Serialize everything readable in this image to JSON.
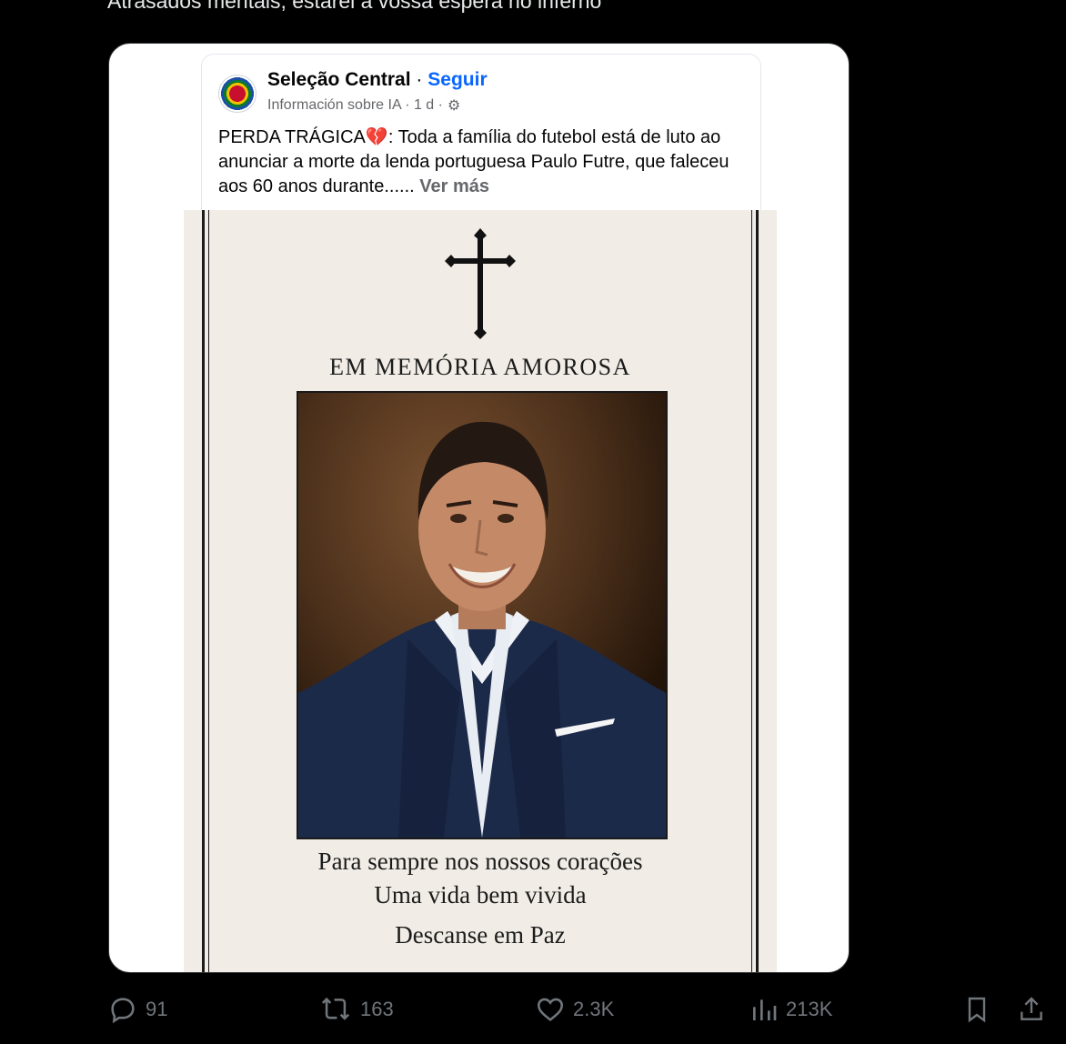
{
  "tweet": {
    "text": "Atrasados mentais, estarei à vossa espera no inferno"
  },
  "fb_post": {
    "page_name": "Seleção Central",
    "separator": "·",
    "follow": "Seguir",
    "meta_info": "Información sobre IA · 1 d ·",
    "text_before_emoji": "PERDA TRÁGICA",
    "emoji": "💔",
    "text_after_emoji": ": Toda a família do futebol está de luto ao anunciar a morte da lenda portuguesa Paulo Futre, que faleceu aos 60 anos durante......",
    "see_more": "Ver más"
  },
  "memorial": {
    "title": "EM MEMÓRIA AMOROSA",
    "line1": "Para sempre nos nossos corações",
    "line2": "Uma vida bem vivida",
    "line3": "Descanse em Paz"
  },
  "actions": {
    "replies": "91",
    "reposts": "163",
    "likes": "2.3K",
    "views": "213K"
  },
  "icons": {
    "reply": "reply-icon",
    "repost": "repost-icon",
    "like": "like-icon",
    "views": "views-icon",
    "bookmark": "bookmark-icon",
    "share": "share-icon",
    "settings": "gear-icon"
  },
  "colors": {
    "background": "#000000",
    "text": "#e7e9ea",
    "muted": "#71767b",
    "link": "#0866ff"
  }
}
